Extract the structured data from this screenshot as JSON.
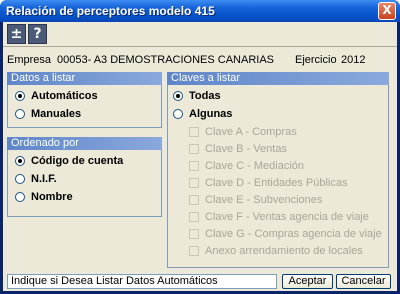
{
  "window": {
    "title": "Relación de perceptores modelo 415",
    "close_symbol": "X"
  },
  "toolbar": {
    "btn1_symbol": "±",
    "btn2_symbol": "?"
  },
  "header": {
    "empresa_label": "Empresa",
    "empresa_value": "00053- A3 DEMOSTRACIONES CANARIAS",
    "ejercicio_label": "Ejercicio",
    "ejercicio_value": "2012"
  },
  "datos": {
    "title": "Datos a listar",
    "options": [
      "Automáticos",
      "Manuales"
    ],
    "selected": 0
  },
  "ordenado": {
    "title": "Ordenado por",
    "options": [
      "Código de cuenta",
      "N.I.F.",
      "Nombre"
    ],
    "selected": 0
  },
  "claves": {
    "title": "Claves a listar",
    "options": [
      "Todas",
      "Algunas"
    ],
    "selected": 0,
    "items": [
      "Clave A - Compras",
      "Clave B - Ventas",
      "Clave C - Mediación",
      "Clave D - Entidades Públicas",
      "Clave E - Subvenciones",
      "Clave F - Ventas agencia de viaje",
      "Clave G - Compras agencia de viaje",
      "Anexo arrendamiento de locales"
    ]
  },
  "status": {
    "text": "Indique si Desea Listar Datos Automáticos"
  },
  "buttons": {
    "accept": "Aceptar",
    "cancel": "Cancelar"
  }
}
